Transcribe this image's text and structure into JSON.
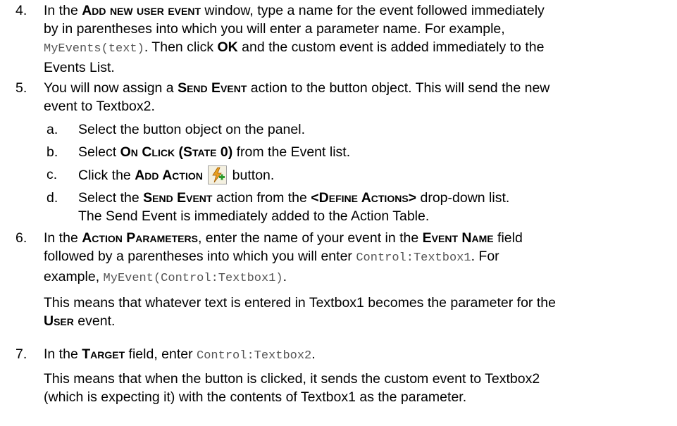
{
  "steps": [
    {
      "number": "4.",
      "p1": "In the ",
      "b1": "Add new user event",
      "p2": " window, type a name for the event followed immediately",
      "line2": "by in parentheses into which you will enter a parameter name. For example,",
      "code1": "MyEvents(text)",
      "p3": ". Then click ",
      "b2": "OK",
      "p4": " and the custom event is added immediately to the",
      "line4": "Events List."
    },
    {
      "number": "5.",
      "p1": "You will now assign a ",
      "b1": "Send Event",
      "p2": " action to the button object. This will send the new",
      "line2": "event to Textbox2.",
      "substeps": [
        {
          "letter": "a.",
          "text": "Select the button object on the panel."
        },
        {
          "letter": "b.",
          "p1": "Select ",
          "b1": "On Click (State 0)",
          "p2": " from the Event list."
        },
        {
          "letter": "c.",
          "p1": "Click the ",
          "b1": "Add Action",
          "p2": " button.",
          "icon": "add-action-lightning-icon"
        },
        {
          "letter": "d.",
          "p1": "Select the ",
          "b1": "Send Event",
          "p2": " action from the ",
          "b2": "<Define Actions>",
          "p3": " drop-down list.",
          "line2": "The Send Event is immediately added to the Action Table."
        }
      ]
    },
    {
      "number": "6.",
      "p1": "In the ",
      "b1": "Action Parameters",
      "p2": ", enter the name of your event in the ",
      "b2": "Event Name",
      "p3": " field",
      "line2a": "followed by a parentheses into which you will enter ",
      "code1": "Control:Textbox1",
      "line2b": ". For",
      "line3a": "example, ",
      "code2": "MyEvent(Control:Textbox1)",
      "line3b": ".",
      "note1": "This means that whatever text is entered in Textbox1 becomes the parameter for the",
      "note_b": "User",
      "note2": " event."
    },
    {
      "number": "7.",
      "p1": "In the ",
      "b1": "Target",
      "p2": " field, enter ",
      "code1": "Control:Textbox2",
      "p3": ".",
      "note1": "This means that when the button is clicked, it sends the custom event to Textbox2",
      "note2": "(which is expecting it) with the contents of Textbox1 as the parameter."
    }
  ],
  "colors": {
    "text": "#000000",
    "code": "#555555"
  }
}
